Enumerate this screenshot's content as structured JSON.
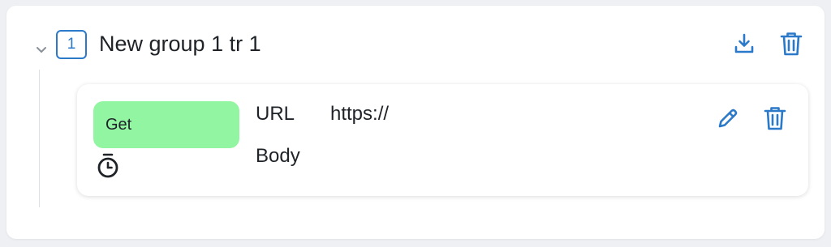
{
  "group": {
    "index": "1",
    "title": "New group 1 tr 1",
    "icons": {
      "toggle": "chevron-down-icon",
      "download": "download-icon",
      "delete": "trash-icon"
    }
  },
  "request": {
    "method": "Get",
    "url_label": "URL",
    "url_value": "https://",
    "body_label": "Body",
    "icons": {
      "timer": "stopwatch-icon",
      "edit": "pencil-icon",
      "delete": "trash-icon"
    }
  },
  "colors": {
    "accent": "#2b79c9",
    "method_get_bg": "#91f5a2",
    "text": "#1f2328",
    "page_bg": "#eef0f4",
    "card_bg": "#ffffff"
  }
}
